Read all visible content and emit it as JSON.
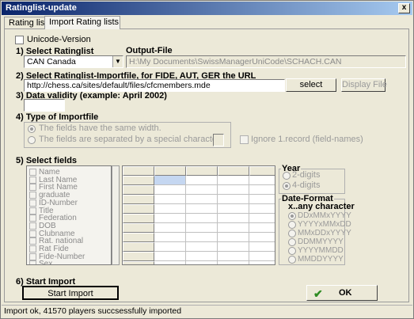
{
  "window": {
    "title": "Ratinglist-update",
    "close": "x"
  },
  "tabs": [
    "Rating lists",
    "Import Rating lists"
  ],
  "unicode": {
    "label": "Unicode-Version"
  },
  "step1": {
    "label": "1) Select Ratinglist",
    "value": "CAN Canada"
  },
  "output": {
    "label": "Output-File",
    "value": "H:\\My Documents\\SwissManagerUniCode\\SCHACH.CAN"
  },
  "step2": {
    "label": "2) Select Ratinglist-Importfile, for FIDE, AUT, GER the URL",
    "value": "http://chess.ca/sites/default/files/cfcmembers.mde",
    "select_btn": "select",
    "display_btn": "Display File"
  },
  "step3": {
    "label": "3) Data validity (example: April 2002)",
    "value": ""
  },
  "step4": {
    "label": "4) Type of Importfile",
    "opt1": "The fields have the same width.",
    "opt2": "The fields are separated by a special character.",
    "ignore": "Ignore 1.record (field-names)"
  },
  "step5": {
    "label": "5) Select fields",
    "fields": [
      "Name",
      "Last Name",
      "First Name",
      "graduate",
      "ID-Number",
      "Title",
      "Federation",
      "DOB",
      "Clubname",
      "Rat. national",
      "Rat Fide",
      "Fide-Number",
      "Sex"
    ]
  },
  "year": {
    "title": "Year",
    "options": [
      "2-digits",
      "4-digits"
    ]
  },
  "dateformat": {
    "title": "Date-Format",
    "subtitle": "x..any character",
    "options": [
      "DDxMMxYYYY",
      "YYYYxMMxDD",
      "MMxDDxYYYY",
      "DDMMYYYY",
      "YYYYMMDD",
      "MMDDYYYY"
    ]
  },
  "step6": {
    "label": "6) Start Import",
    "button": "Start Import"
  },
  "ok_button": "OK",
  "status": "Import ok, 41570 players succsessfully imported"
}
